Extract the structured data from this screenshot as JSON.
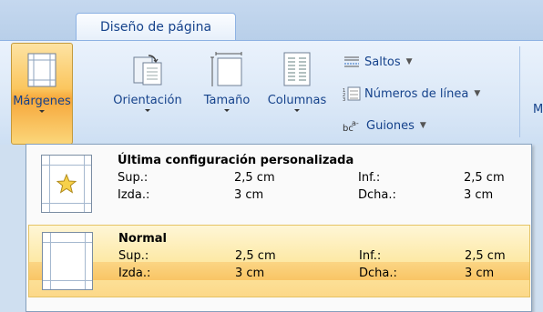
{
  "ribbon": {
    "active_tab": "Diseño de página",
    "cut_label": "M",
    "buttons": {
      "margenes": "Márgenes",
      "orientacion": "Orientación",
      "tamano": "Tamaño",
      "columnas": "Columnas"
    },
    "small_buttons": {
      "saltos": "Saltos",
      "numeros_linea": "Números de línea",
      "guiones": "Guiones"
    }
  },
  "margins_gallery": {
    "entries": [
      {
        "title": "Última configuración personalizada",
        "sup_label": "Sup.:",
        "sup_value": "2,5 cm",
        "inf_label": "Inf.:",
        "inf_value": "2,5 cm",
        "izda_label": "Izda.:",
        "izda_value": "3 cm",
        "dcha_label": "Dcha.:",
        "dcha_value": "3 cm",
        "icon": "star-page-icon"
      },
      {
        "title": "Normal",
        "sup_label": "Sup.:",
        "sup_value": "2,5 cm",
        "inf_label": "Inf.:",
        "inf_value": "2,5 cm",
        "izda_label": "Izda.:",
        "izda_value": "3 cm",
        "dcha_label": "Dcha.:",
        "dcha_value": "3 cm",
        "icon": "normal-page-icon",
        "highlighted": true
      }
    ]
  },
  "colors": {
    "ribbon_text": "#15428b",
    "highlight": "#fbc65e"
  }
}
